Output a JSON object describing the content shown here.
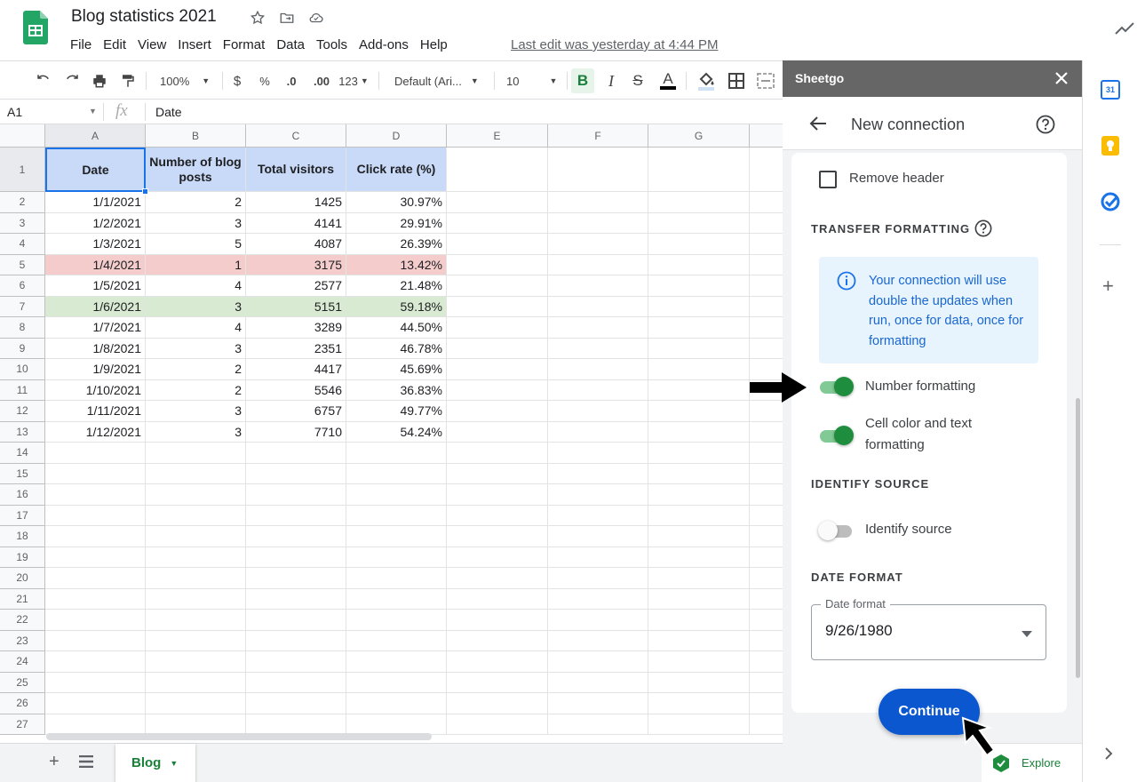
{
  "app": {
    "title": "Blog statistics 2021",
    "last_edit": "Last edit was yesterday at 4:44 PM",
    "menu": [
      "File",
      "Edit",
      "View",
      "Insert",
      "Format",
      "Data",
      "Tools",
      "Add-ons",
      "Help"
    ]
  },
  "toolbar": {
    "zoom": "100%",
    "currency": "$",
    "percent": "%",
    "decrease_decimals": ".0",
    "increase_decimals": ".00",
    "more_formats": "123",
    "font": "Default (Ari...",
    "font_size": "10"
  },
  "formula_bar": {
    "cell_ref": "A1",
    "fx": "fx",
    "content": "Date"
  },
  "sheet": {
    "columns": [
      "A",
      "B",
      "C",
      "D",
      "E",
      "F",
      "G"
    ],
    "row_numbers": [
      "1",
      "2",
      "3",
      "4",
      "5",
      "6",
      "7",
      "8",
      "9",
      "10",
      "11",
      "12",
      "13",
      "14",
      "15",
      "16",
      "17",
      "18",
      "19",
      "20",
      "21",
      "22",
      "23",
      "24",
      "25",
      "26",
      "27"
    ],
    "headers": [
      "Date",
      "Number of blog posts",
      "Total visitors",
      "Click rate (%)"
    ],
    "rows": [
      [
        "1/1/2021",
        "2",
        "1425",
        "30.97%"
      ],
      [
        "1/2/2021",
        "3",
        "4141",
        "29.91%"
      ],
      [
        "1/3/2021",
        "5",
        "4087",
        "26.39%"
      ],
      [
        "1/4/2021",
        "1",
        "3175",
        "13.42%"
      ],
      [
        "1/5/2021",
        "4",
        "2577",
        "21.48%"
      ],
      [
        "1/6/2021",
        "3",
        "5151",
        "59.18%"
      ],
      [
        "1/7/2021",
        "4",
        "3289",
        "44.50%"
      ],
      [
        "1/8/2021",
        "3",
        "2351",
        "46.78%"
      ],
      [
        "1/9/2021",
        "2",
        "4417",
        "45.69%"
      ],
      [
        "1/10/2021",
        "2",
        "5546",
        "36.83%"
      ],
      [
        "1/11/2021",
        "3",
        "6757",
        "49.77%"
      ],
      [
        "1/12/2021",
        "3",
        "7710",
        "54.24%"
      ]
    ],
    "highlight": {
      "red_row": 3,
      "green_row": 5,
      "red_color": "#f4cccc",
      "green_color": "#d9ead3",
      "header_color": "#c9daf8"
    }
  },
  "tabs": {
    "active": "Blog",
    "explore": "Explore"
  },
  "panel": {
    "app_name": "Sheetgo",
    "title": "New connection",
    "remove_header": "Remove header",
    "transfer_formatting_title": "TRANSFER FORMATTING",
    "info_text": "Your connection will use double the updates when run, once for data, once for formatting",
    "number_formatting": "Number formatting",
    "cell_color_formatting": "Cell color and text formatting",
    "identify_source_title": "IDENTIFY SOURCE",
    "identify_source": "Identify source",
    "date_format_title": "DATE FORMAT",
    "date_format_label": "Date format",
    "date_format_value": "9/26/1980",
    "continue": "Continue",
    "toggles": {
      "number_formatting": true,
      "cell_color": true,
      "identify_source": false
    },
    "accent_color": "#1e8e3e",
    "button_color": "#0b57d0"
  }
}
